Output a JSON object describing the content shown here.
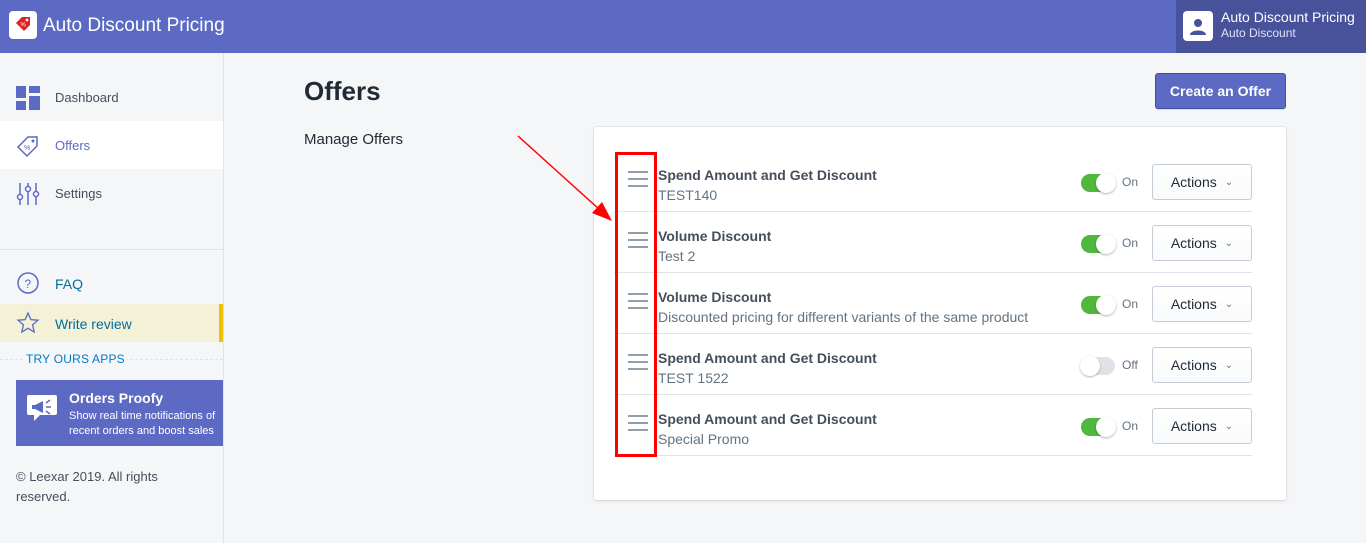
{
  "header": {
    "app_title": "Auto Discount Pricing",
    "user_name": "Auto Discount Pricing",
    "user_sub": "Auto Discount",
    "brand_color": "#5c6ac4"
  },
  "sidebar": {
    "items": [
      {
        "label": "Dashboard",
        "icon": "dashboard-icon"
      },
      {
        "label": "Offers",
        "icon": "tag-icon"
      },
      {
        "label": "Settings",
        "icon": "sliders-icon"
      }
    ],
    "faq_label": "FAQ",
    "review_label": "Write review",
    "try_apps": "TRY OURS APPS",
    "promo": {
      "title": "Orders Proofy",
      "desc": "Show real time notifications of recent orders and boost sales"
    },
    "copyright": "© Leexar 2019. All rights reserved."
  },
  "main": {
    "title": "Offers",
    "create_button": "Create an Offer",
    "section_label": "Manage Offers",
    "actions_label": "Actions",
    "offers": [
      {
        "title": "Spend Amount and Get Discount",
        "subtitle": "TEST140",
        "status": "On"
      },
      {
        "title": "Volume Discount",
        "subtitle": "Test 2",
        "status": "On"
      },
      {
        "title": "Volume Discount",
        "subtitle": "Discounted pricing for different variants of the same product",
        "status": "On"
      },
      {
        "title": "Spend Amount and Get Discount",
        "subtitle": "TEST 1522",
        "status": "Off"
      },
      {
        "title": "Spend Amount and Get Discount",
        "subtitle": "Special Promo",
        "status": "On"
      }
    ]
  }
}
